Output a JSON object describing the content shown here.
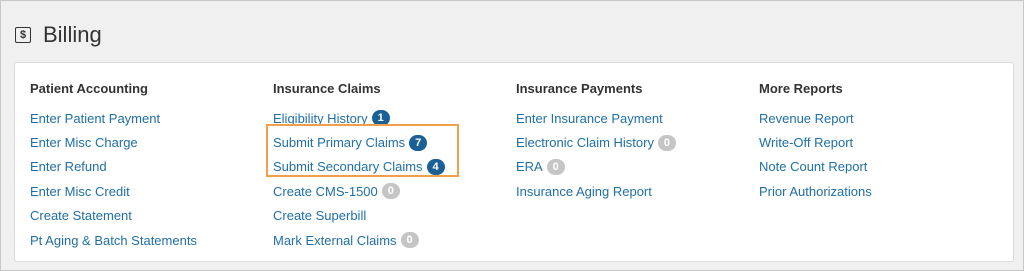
{
  "header": {
    "title": "Billing",
    "icon": "dollar-icon",
    "icon_glyph": "$"
  },
  "columns": [
    {
      "heading": "Patient Accounting",
      "items": [
        {
          "label": "Enter Patient Payment"
        },
        {
          "label": "Enter Misc Charge"
        },
        {
          "label": "Enter Refund"
        },
        {
          "label": "Enter Misc Credit"
        },
        {
          "label": "Create Statement"
        },
        {
          "label": "Pt Aging & Batch Statements"
        }
      ]
    },
    {
      "heading": "Insurance Claims",
      "items": [
        {
          "label": "Eligibility History",
          "badge": "1",
          "badge_color": "blue"
        },
        {
          "label": "Submit Primary Claims",
          "badge": "7",
          "badge_color": "blue"
        },
        {
          "label": "Submit Secondary Claims",
          "badge": "4",
          "badge_color": "blue"
        },
        {
          "label": "Create CMS-1500",
          "badge": "0",
          "badge_color": "gray"
        },
        {
          "label": "Create Superbill"
        },
        {
          "label": "Mark External Claims",
          "badge": "0",
          "badge_color": "gray"
        }
      ]
    },
    {
      "heading": "Insurance Payments",
      "items": [
        {
          "label": "Enter Insurance Payment"
        },
        {
          "label": "Electronic Claim History",
          "badge": "0",
          "badge_color": "gray"
        },
        {
          "label": "ERA",
          "badge": "0",
          "badge_color": "gray"
        },
        {
          "label": "Insurance Aging Report"
        }
      ]
    },
    {
      "heading": "More Reports",
      "items": [
        {
          "label": "Revenue Report"
        },
        {
          "label": "Write-Off Report"
        },
        {
          "label": "Note Count Report"
        },
        {
          "label": "Prior Authorizations"
        }
      ]
    }
  ],
  "colors": {
    "link": "#1f6fa8",
    "badge_blue": "#1a5f96",
    "badge_gray": "#c5c5c5",
    "highlight": "#f0a04b"
  }
}
